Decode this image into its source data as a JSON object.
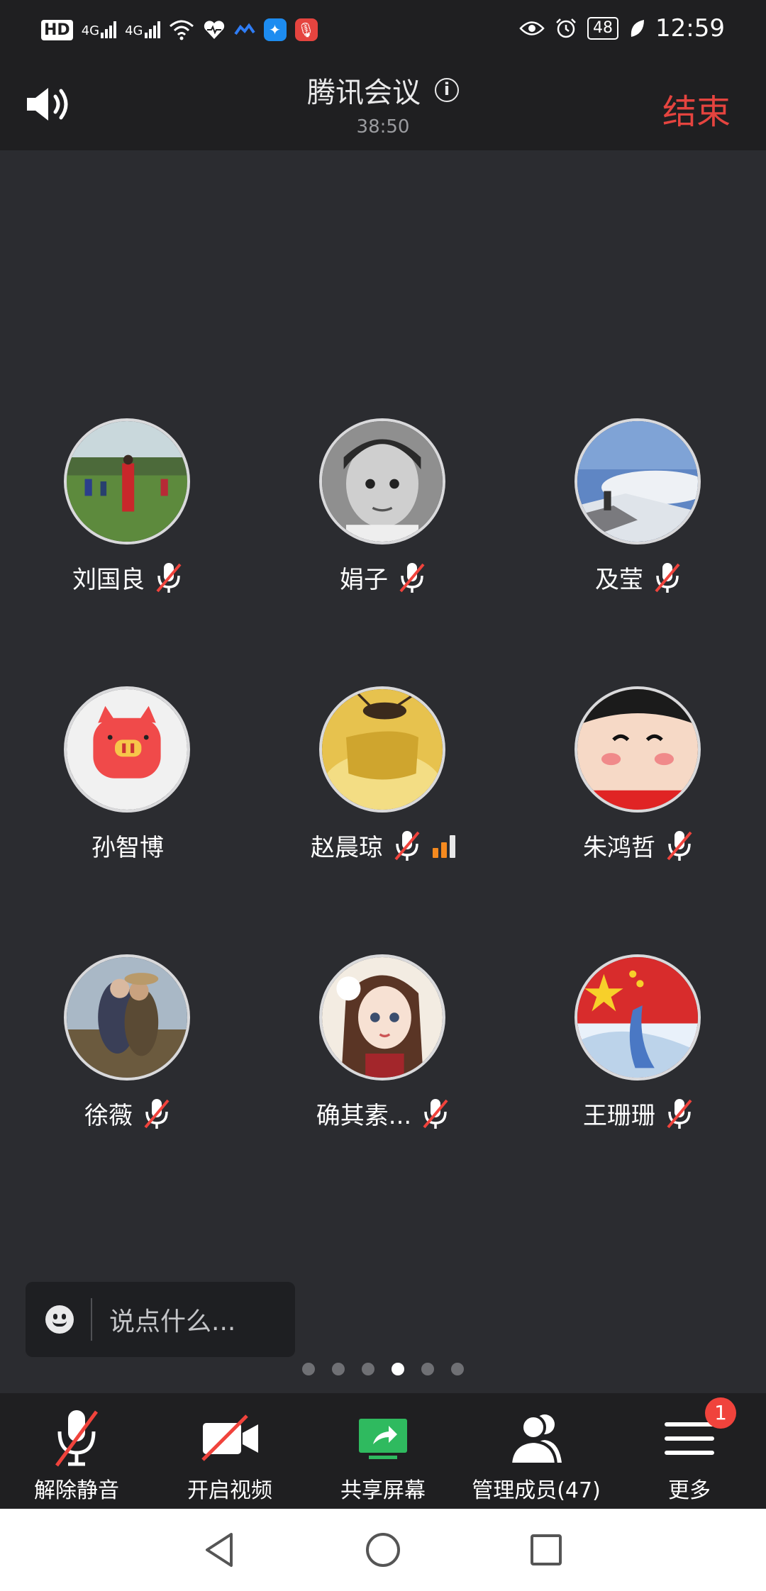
{
  "status_bar": {
    "network": "HD",
    "signal_labels": [
      "4G",
      "4G"
    ],
    "battery": "48",
    "time": "12:59"
  },
  "header": {
    "title": "腾讯会议",
    "timer": "38:50",
    "end_label": "结束"
  },
  "participants": [
    {
      "name": "刘国良",
      "muted": true
    },
    {
      "name": "娟子",
      "muted": true
    },
    {
      "name": "及莹",
      "muted": true
    },
    {
      "name": "孙智博",
      "muted": false
    },
    {
      "name": "赵晨琼",
      "muted": true,
      "signal_bars": 2
    },
    {
      "name": "朱鸿哲",
      "muted": true
    },
    {
      "name": "徐薇",
      "muted": true
    },
    {
      "name": "确其素...",
      "muted": true
    },
    {
      "name": "王珊珊",
      "muted": true
    }
  ],
  "chat": {
    "placeholder": "说点什么..."
  },
  "pagination": {
    "total_pages": 6,
    "current_page": 4
  },
  "toolbar": {
    "unmute": "解除静音",
    "start_video": "开启视频",
    "share_screen": "共享屏幕",
    "manage_members": "管理成员(47)",
    "more": "更多",
    "more_badge": "1"
  },
  "colors": {
    "end_red": "#e5443f",
    "share_green": "#2fba5f",
    "badge_red": "#f0433c",
    "mute_red": "#f0433c"
  }
}
